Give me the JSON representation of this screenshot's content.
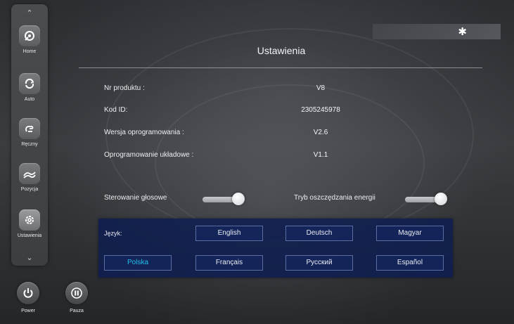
{
  "sidebar": {
    "items": [
      {
        "label": "Home",
        "icon": "home-gear-icon"
      },
      {
        "label": "Auto",
        "icon": "auto-cycle-icon"
      },
      {
        "label": "Ręczny",
        "icon": "manual-hand-icon"
      },
      {
        "label": "Pozycja",
        "icon": "position-recline-icon"
      },
      {
        "label": "Ustawienia",
        "icon": "settings-gear-icon"
      }
    ]
  },
  "bottom": {
    "power_label": "Power",
    "pause_label": "Pauza"
  },
  "page": {
    "title": "Ustawienia"
  },
  "info": {
    "rows": [
      {
        "label": "Nr produktu :",
        "value": "V8"
      },
      {
        "label": "Kod ID:",
        "value": "2305245978"
      },
      {
        "label": "Wersja oprogramowania :",
        "value": "V2.6"
      },
      {
        "label": "Oprogramowanie układowe :",
        "value": "V1.1"
      }
    ]
  },
  "toggles": {
    "voice_label": "Sterowanie głosowe",
    "voice_on": true,
    "energy_label": "Tryb oszczędzania energii",
    "energy_on": true
  },
  "language": {
    "label": "Język:",
    "selected": "Polska",
    "options": [
      "English",
      "Deutsch",
      "Magyar",
      "Polska",
      "Français",
      "Русский",
      "Español"
    ]
  },
  "colors": {
    "accent": "#20c0e8",
    "panel": "#0f1e50"
  }
}
